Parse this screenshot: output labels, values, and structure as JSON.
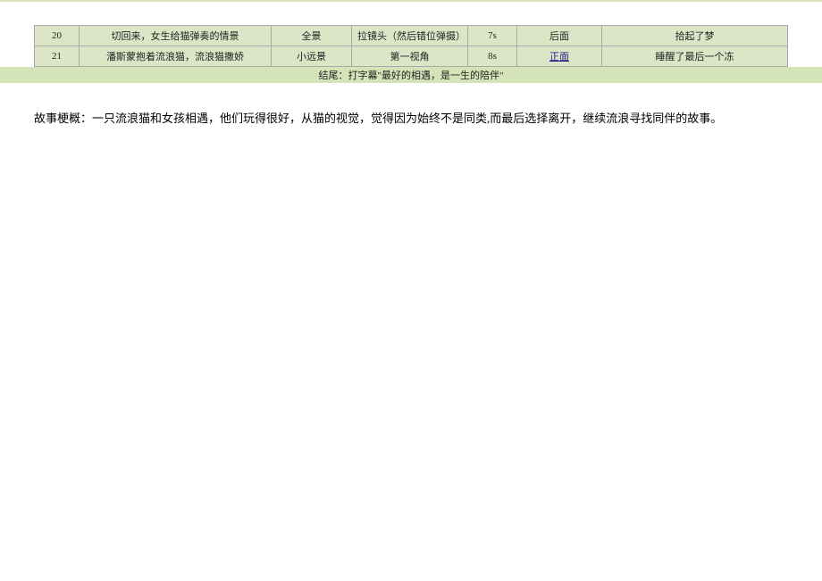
{
  "table": {
    "rows": [
      {
        "num": "20",
        "desc": "切回来，女生给猫弹奏的情景",
        "shot": "全景",
        "camera": "拉镜头（然后错位弹摄）",
        "time": "7s",
        "direction": "后面",
        "note": "拾起了梦"
      },
      {
        "num": "21",
        "desc": "潘斯蒙抱着流浪猫，流浪猫撒娇",
        "shot": "小远景",
        "camera": "第一视角",
        "time": "8s",
        "direction": "正面",
        "note": "睡醒了最后一个冻"
      }
    ]
  },
  "ending": "结尾：打字幕\"最好的相遇，是一生的陪伴\"",
  "synopsis": "故事梗概：一只流浪猫和女孩相遇，他们玩得很好，从猫的视觉，觉得因为始终不是同类,而最后选择离开，继续流浪寻找同伴的故事。"
}
